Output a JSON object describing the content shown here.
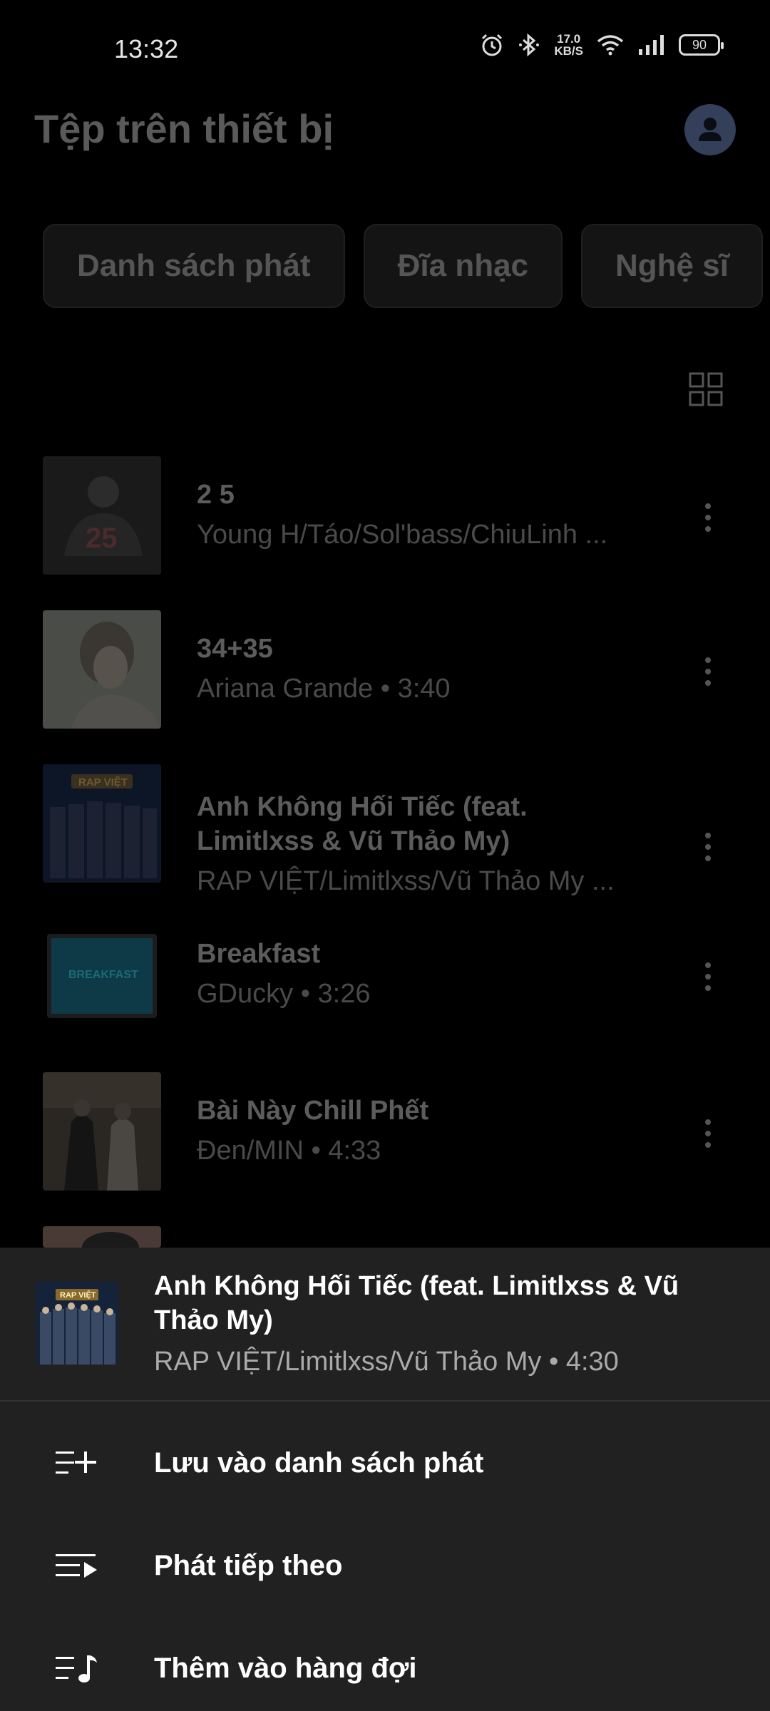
{
  "status_bar": {
    "time": "13:32",
    "net_speed_value": "17.0",
    "net_speed_unit": "KB/S",
    "battery": "90",
    "icons": [
      "alarm-icon",
      "bluetooth-icon",
      "wifi-icon",
      "signal-icon",
      "battery-icon"
    ]
  },
  "header": {
    "title": "Tệp trên thiết bị",
    "avatar_icon": "account-icon"
  },
  "chips": [
    {
      "label": "Danh sách phát"
    },
    {
      "label": "Đĩa nhạc"
    },
    {
      "label": "Nghệ sĩ"
    }
  ],
  "view_toggle_icon": "grid-view-icon",
  "songs": [
    {
      "title": "2 5",
      "subtitle": "Young H/Táo/Sol'bass/ChiuLinh ..."
    },
    {
      "title": "34+35",
      "subtitle": "Ariana Grande • 3:40"
    },
    {
      "title": "Anh Không Hối Tiếc (feat.",
      "title_line2": "Limitlxss & Vũ Thảo My)",
      "subtitle": "RAP VIỆT/Limitlxss/Vũ Thảo My ..."
    },
    {
      "title": "Breakfast",
      "subtitle": "GDucky • 3:26"
    },
    {
      "title": "Bài Này Chill Phết",
      "subtitle": "Đen/MIN • 4:33"
    }
  ],
  "sheet": {
    "title": "Anh Không Hối Tiếc (feat. Limitlxss & Vũ Thảo My)",
    "subtitle": "RAP VIỆT/Limitlxss/Vũ Thảo My • 4:30",
    "menu": [
      {
        "label": "Lưu vào danh sách phát",
        "icon": "playlist-add-icon"
      },
      {
        "label": "Phát tiếp theo",
        "icon": "play-next-icon"
      },
      {
        "label": "Thêm vào hàng đợi",
        "icon": "add-to-queue-icon"
      }
    ]
  },
  "colors": {
    "background": "#000000",
    "sheet": "#212121",
    "avatar": "#34405a",
    "dim_text": "#5c5c5c"
  }
}
